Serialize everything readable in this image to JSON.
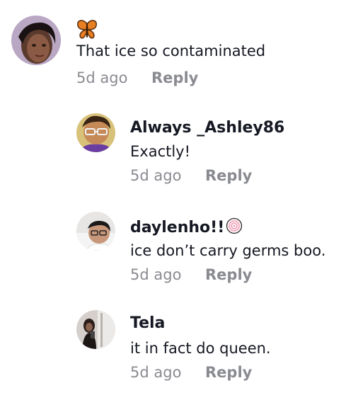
{
  "comments": [
    {
      "username_emoji": "butterfly-icon",
      "text": "That ice so contaminated",
      "time": "5d ago",
      "reply_label": "Reply"
    },
    {
      "username": "Always _Ashley86",
      "text": "Exactly!",
      "time": "5d ago",
      "reply_label": "Reply"
    },
    {
      "username": "daylenho!!",
      "username_badge": "lollipop-icon",
      "text": "ice don’t carry germs boo.",
      "time": "5d ago",
      "reply_label": "Reply"
    },
    {
      "username": "Tela",
      "text": "it in fact do queen.",
      "time": "5d ago",
      "reply_label": "Reply"
    }
  ],
  "colors": {
    "text": "#161823",
    "secondary": "#8a8b91",
    "butterfly": "#e67e22"
  }
}
